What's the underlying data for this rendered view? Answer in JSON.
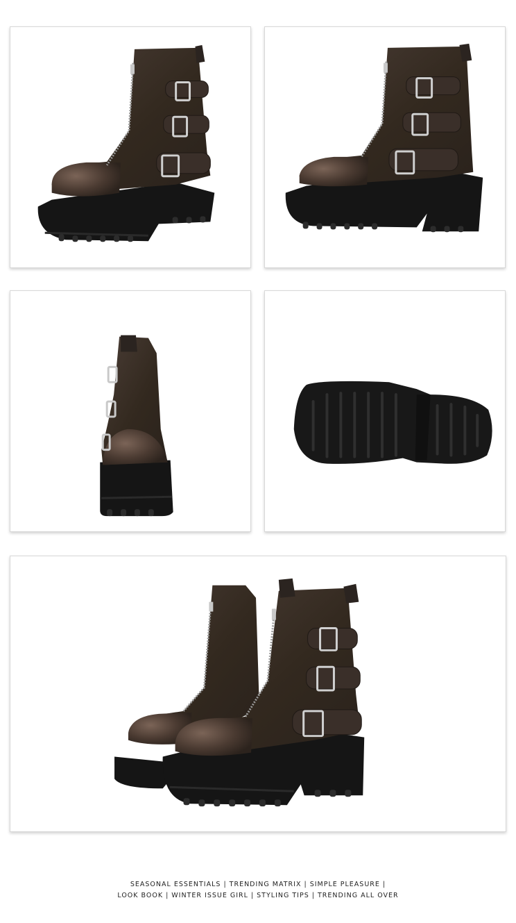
{
  "photos": [
    {
      "name": "boot-front-three-quarter-photo"
    },
    {
      "name": "boot-side-photo"
    },
    {
      "name": "boot-back-photo"
    },
    {
      "name": "boot-sole-photo"
    },
    {
      "name": "boot-pair-photo"
    }
  ],
  "colors": {
    "leather": "#3b302a",
    "leather_highlight": "#6a5548",
    "sole": "#151515",
    "buckle": "#c9c9c9",
    "text": "#222222"
  },
  "tagline": {
    "line1": "SEASONAL ESSENTIALS | TRENDING MATRIX | SIMPLE PLEASURE |",
    "line2": "LOOK BOOK | WINTER ISSUE GIRL | STYLING TIPS | TRENDING ALL OVER"
  }
}
